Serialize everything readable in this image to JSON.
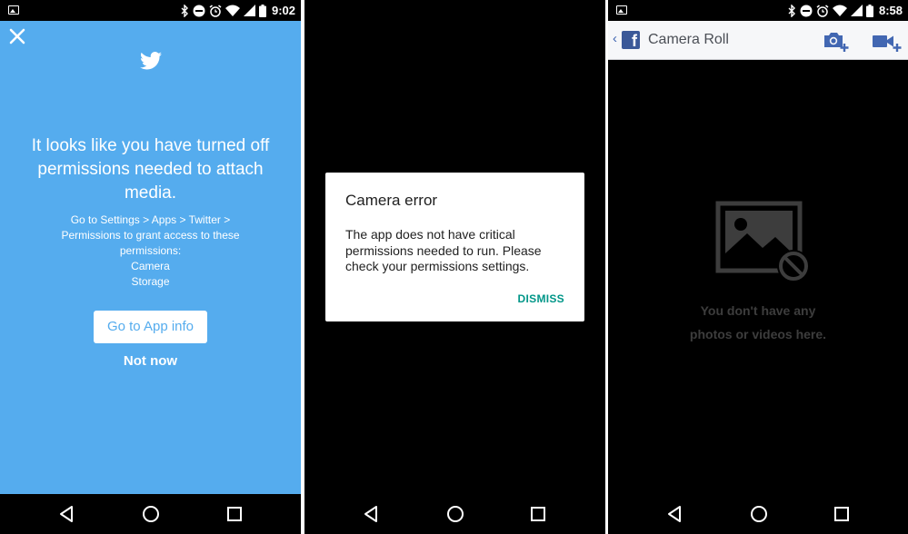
{
  "colors": {
    "twitter_blue": "#55acee",
    "dialog_accent": "#009688",
    "facebook_blue": "#3b5998"
  },
  "twitter_panel": {
    "status_time": "9:02",
    "close_icon": "close-icon",
    "logo_icon": "twitter-bird-icon",
    "headline": "It looks like you have turned off permissions needed to attach media.",
    "instructions": [
      "Go to Settings > Apps > Twitter >",
      "Permissions to grant access to these",
      "permissions:",
      "Camera",
      "Storage"
    ],
    "primary_button": "Go to App info",
    "secondary_button": "Not now"
  },
  "camera_panel": {
    "dialog": {
      "title": "Camera error",
      "message": "The app does not have critical permissions needed to run. Please check your permissions settings.",
      "dismiss_label": "DISMISS"
    }
  },
  "facebook_panel": {
    "status_time": "8:58",
    "back_glyph": "‹",
    "logo_glyph": "f",
    "title": "Camera Roll",
    "add_photo_icon": "camera-add-icon",
    "add_video_icon": "video-add-icon",
    "empty_icon": "no-photos-icon",
    "empty_message": [
      "You don't have any",
      "photos or videos here."
    ]
  },
  "status_icons": [
    "bluetooth-icon",
    "do-not-disturb-icon",
    "alarm-icon",
    "wifi-icon",
    "signal-icon",
    "battery-icon"
  ],
  "nav_icons": [
    "back-nav-icon",
    "home-nav-icon",
    "recents-nav-icon"
  ]
}
